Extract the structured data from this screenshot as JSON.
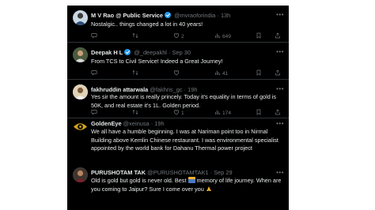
{
  "tweets": [
    {
      "name": "M V Rao @ Public Service",
      "handle": "@mvraoforindia",
      "sep": "·",
      "time": "13h",
      "text": "Nostalgic.. things changed a lot in 40 years!",
      "replies": "",
      "retweets": "",
      "likes": "2",
      "views": "649",
      "verified": true,
      "avatar_color": "#c9d6e3"
    },
    {
      "name": "Deepak H L",
      "handle": "@_deepakhl",
      "sep": "·",
      "time": "Sep 30",
      "text": "From TCS to Civil Service! Indeed a Great Journey!",
      "replies": "",
      "retweets": "",
      "likes": "",
      "views": "41",
      "verified": true,
      "avatar_color": "#6b6f58"
    },
    {
      "name": "fakhruddin attarwala",
      "handle": "@fakhris_gc",
      "sep": "·",
      "time": "19h",
      "text": "Yes sir the amount is really princely. Today  it's equality in terms of gold is 50K, and real estate it's 1L.  Golden period.",
      "replies": "",
      "retweets": "",
      "likes": "1",
      "views": "174",
      "verified": false,
      "avatar_color": "#d9c7a8"
    },
    {
      "name": "GoldenEye",
      "handle": "@xeinusa",
      "sep": "·",
      "time": "19h",
      "text": "We all have a humble beginning. I was at Nariman point too in Nirmal Building above Kemlin Chinese restaurant. I was environmental specialist appointed by the world bank for Dahanu Thermal power project",
      "replies": "",
      "retweets": "",
      "likes": "",
      "views": "",
      "verified": false,
      "avatar_color": "#d1a21c"
    },
    {
      "name": "PURUSHOTAM TAK",
      "handle": "@PURUSHOTAMTAK1",
      "sep": "·",
      "time": "Sep 29",
      "text_before": "Old is gold but gold is never old.  Best",
      "text_after": "memory of life journey. When are you coming to Jaipur?  Sure I come over you",
      "replies": "",
      "retweets": "",
      "likes": "",
      "views": "",
      "verified": false,
      "avatar_color": "#5a4a40"
    }
  ],
  "colors": {
    "background": "#000000",
    "text_primary": "#e7e9ea",
    "text_secondary": "#71767b",
    "verified": "#1d9bf0",
    "divider": "#2f3336"
  },
  "icons": [
    "reply-icon",
    "retweet-icon",
    "like-icon",
    "views-icon",
    "bookmark-icon",
    "share-icon",
    "more-icon",
    "verified-icon"
  ]
}
